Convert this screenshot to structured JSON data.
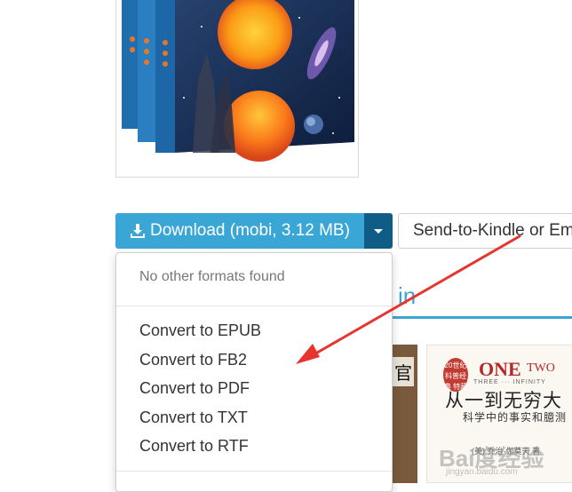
{
  "download_button": {
    "label": "Download (mobi, 3.12 MB)",
    "icon": "download-icon",
    "color": "#3aa6d5"
  },
  "caret_color": "#0f5c87",
  "send_button": {
    "label": "Send-to-Kindle or Em"
  },
  "section_tab": {
    "label": "in",
    "color": "#3aa6d5"
  },
  "dropdown": {
    "header": "No other formats found",
    "items": [
      "Convert to EPUB",
      "Convert to FB2",
      "Convert to PDF",
      "Convert to TXT",
      "Convert to RTF"
    ]
  },
  "thumbnails": {
    "left_glyph": "官",
    "right_book": {
      "badge": "20世纪 科普经典 特藏",
      "title_en_one": "ONE",
      "title_en_two": "TWO",
      "subtitle_en": "THREE ··· INFINITY",
      "title_cn": "从一到无穷大",
      "tagline_cn": "科学中的事实和臆测",
      "author": "(美) 乔治·伽莫夫 著"
    }
  },
  "watermark": {
    "text": "Bai度经验",
    "sub": "jingyan.baidu.com"
  },
  "arrow_color": "#e8342e"
}
